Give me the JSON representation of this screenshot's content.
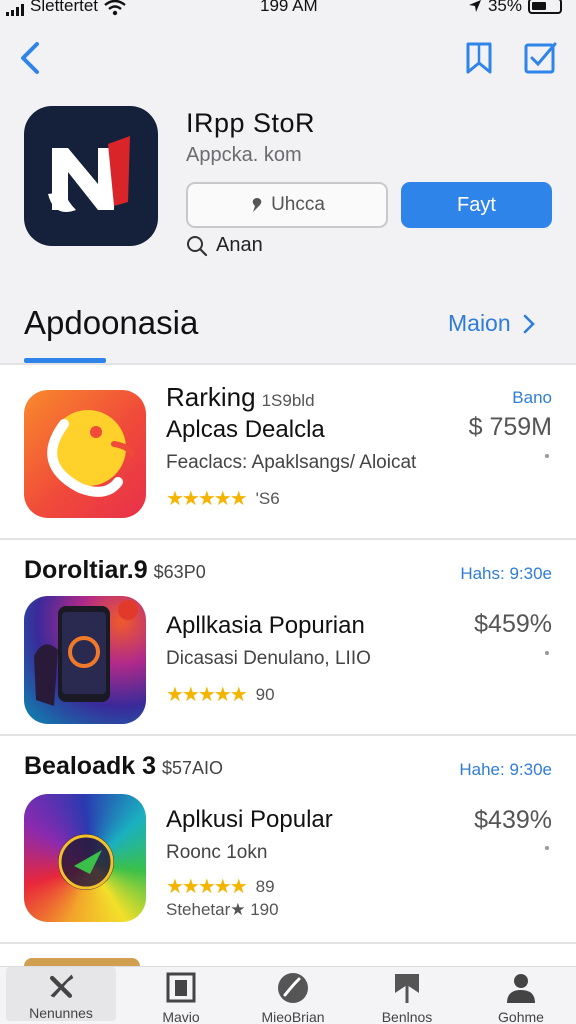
{
  "status_bar": {
    "carrier": "Slettertet",
    "time": "199 AM",
    "battery": "35%"
  },
  "header": {
    "app_title": "IRpp StoR",
    "app_subtitle": "Appcka. kom",
    "outline_button": "Uhcca",
    "primary_button": "Fayt",
    "search_label": "Anan"
  },
  "section": {
    "title": "Apdoonasia",
    "more_link": "Maion"
  },
  "featured": {
    "title": "Rarking",
    "title_small": "1S9bld",
    "name": "Aplcas Dealcla",
    "subtitle": "Feaclacs: Apaklsangs/ Aloicat",
    "rating": "'S6",
    "label": "Bano",
    "price": "$ 759M"
  },
  "groups": [
    {
      "header": "Doroltiar.9",
      "header_small": "$63P0",
      "meta": "Hahs: 9:30e",
      "name": "Apllkasia Popurian",
      "subtitle": "Dicasasi Denulano, LIIO",
      "rating": "90",
      "price": "$459%"
    },
    {
      "header": "Bealoadk 3",
      "header_small": "$57AIO",
      "meta": "Hahe: 9:30e",
      "name": "Aplkusi Popular",
      "subtitle": "Roonc 1okn",
      "rating": "89",
      "extra": "Stehetar★ 190",
      "price": "$439%"
    }
  ],
  "tabbar": [
    "Nenunnes",
    "Mavio",
    "MieoBrian",
    "Benlnos",
    "Gohme"
  ],
  "colors": {
    "accent": "#2f84ea",
    "link": "#2f7dd8",
    "star": "#f4b400"
  }
}
